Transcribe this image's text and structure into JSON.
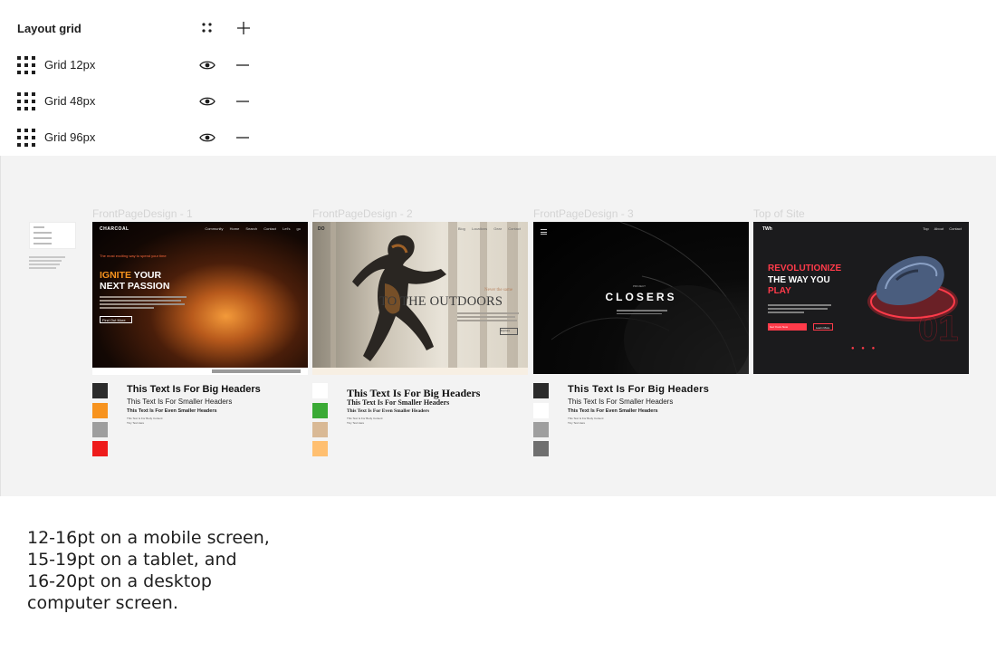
{
  "layout_grid": {
    "title": "Layout grid",
    "header_icons": [
      "style-grid-icon",
      "plus-icon"
    ],
    "rows": [
      {
        "label": "Grid 12px",
        "visible": true
      },
      {
        "label": "Grid 48px",
        "visible": true
      },
      {
        "label": "Grid 96px",
        "visible": true
      }
    ]
  },
  "frames": [
    {
      "name": "FrontPageDesign - 1",
      "brand": "CHARCOAL",
      "nav": "Community Home Search Contact Let's go",
      "kicker": "The most exciting way to spend your time",
      "headline_accent": "IGNITE",
      "headline_rest": " YOUR",
      "headline_line2": "NEXT PASSION",
      "button": "Find Out More",
      "type_specimen": {
        "big": "This Text Is For Big Headers",
        "small": "This Text Is For Smaller Headers",
        "even": "This Text Is For Even Smaller Headers",
        "body": "This Text Is For Body Content",
        "caption": "Tiny Text Here"
      },
      "swatches": [
        "#2b2b2b",
        "#f7931e",
        "#9e9e9e",
        "#ee1c1c"
      ]
    },
    {
      "name": "FrontPageDesign - 2",
      "logo": "DO",
      "nav": "Blog Locations Gear Contact",
      "kicker": "Never the same",
      "headline": "TO THE OUTDOORS",
      "button": "Explore",
      "type_specimen": {
        "big": "This Text Is For Big Headers",
        "small": "This Text Is For Smaller Headers",
        "even": "This Text Is For Even Smaller Headers",
        "body": "This Text Is For Body Content",
        "caption": "Tiny Text Here"
      },
      "swatches": [
        "#ffffff",
        "#3aaa35",
        "#d9b995",
        "#ffbf70"
      ]
    },
    {
      "name": "FrontPageDesign - 3",
      "kicker": "PROJECT",
      "headline": "CLOSERS",
      "type_specimen": {
        "big": "This Text Is For Big Headers",
        "small": "This Text Is For Smaller Headers",
        "even": "This Text Is For Even Smaller Headers",
        "body": "This Text Is For Body Content",
        "caption": "Tiny Text Here"
      },
      "swatches": [
        "#2b2b2b",
        "#ffffff",
        "#9e9e9e",
        "#6f6f6f"
      ]
    },
    {
      "name": "Top of Site",
      "logo": "TWh",
      "nav": "Top About Contact",
      "headline_line1": "REVOLUTIONIZE",
      "headline_line2": "THE WAY YOU",
      "headline_line3": "PLAY",
      "button_primary": "Get Yours Now",
      "button_secondary": "Learn More",
      "big_number": "01"
    }
  ],
  "note": {
    "line1": "12-16pt on a mobile screen,",
    "line2": "15-19pt on a tablet, and",
    "line3": "16-20pt on a desktop",
    "line4": "computer screen."
  }
}
